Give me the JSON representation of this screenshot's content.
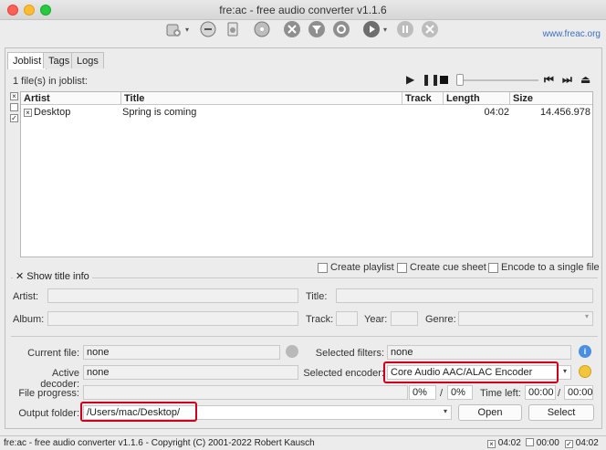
{
  "window": {
    "title": "fre:ac - free audio converter v1.1.6"
  },
  "toolbar": {
    "site_link": "www.freac.org"
  },
  "tabs": [
    "Joblist",
    "Tags",
    "Logs"
  ],
  "joblist": {
    "count_text": "1 file(s) in joblist:",
    "columns": {
      "artist": "Artist",
      "title": "Title",
      "track": "Track",
      "length": "Length",
      "size": "Size"
    },
    "rows": [
      {
        "artist": "Desktop",
        "title": "Spring is coming",
        "track": "",
        "length": "04:02",
        "size": "14.456.978",
        "checked": true
      }
    ]
  },
  "options": {
    "create_playlist": "Create playlist",
    "create_cue_sheet": "Create cue sheet",
    "encode_single": "Encode to a single file"
  },
  "title_info": {
    "toggle": "Show title info",
    "artist_label": "Artist:",
    "title_label": "Title:",
    "album_label": "Album:",
    "track_label": "Track:",
    "year_label": "Year:",
    "genre_label": "Genre:"
  },
  "status": {
    "current_file_label": "Current file:",
    "current_file": "none",
    "selected_filters_label": "Selected filters:",
    "selected_filters": "none",
    "active_decoder_label": "Active decoder:",
    "active_decoder": "none",
    "selected_encoder_label": "Selected encoder:",
    "selected_encoder": "Core Audio AAC/ALAC Encoder",
    "file_progress_label": "File progress:",
    "progress_a": "0%",
    "progress_sep": "/",
    "progress_b": "0%",
    "time_left_label": "Time left:",
    "time_a": "00:00",
    "time_b": "00:00",
    "output_folder_label": "Output folder:",
    "output_folder": "/Users/mac/Desktop/",
    "open_button": "Open",
    "select_button": "Select"
  },
  "statusbar": {
    "text": "fre:ac - free audio converter v1.1.6 - Copyright (C) 2001-2022 Robert Kausch",
    "t1": "04:02",
    "t2": "00:00",
    "t3": "04:02"
  },
  "colors": {
    "highlight": "#d0021b",
    "link": "#3b6fc4"
  }
}
